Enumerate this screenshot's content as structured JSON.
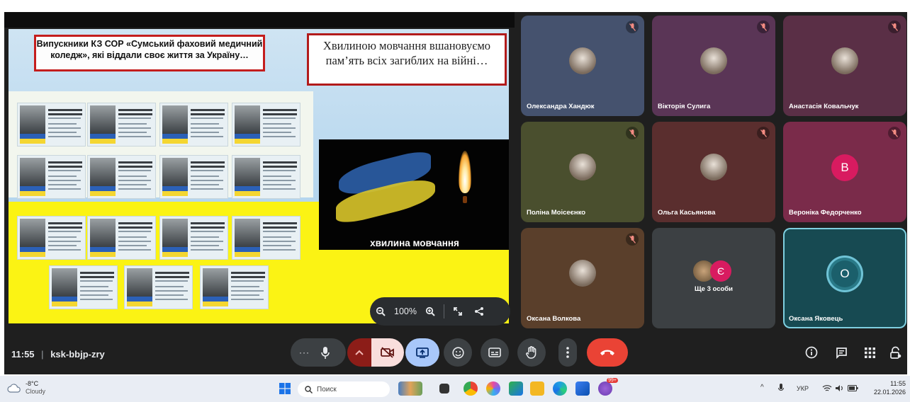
{
  "meeting": {
    "time": "11:55",
    "separator": "|",
    "code": "ksk-bbjp-zry"
  },
  "slide": {
    "title": "Випускники КЗ СОР «Сумський фаховий медичний коледж», які віддали своє життя за Україну…",
    "quote": "Хвилиною мовчання вшановуємо пам’ять всіх загиблих на війні…",
    "video_caption": "хвилина мовчання"
  },
  "zoom_bar": {
    "zoom_out_icon": "zoom-out-icon",
    "zoom_level": "100%",
    "zoom_in_icon": "zoom-in-icon"
  },
  "participants": [
    {
      "name": "Олександра Хандюк",
      "bg": "#45526e",
      "mic": "muted"
    },
    {
      "name": "Вікторія Сулига",
      "bg": "#5a3556",
      "mic": "muted"
    },
    {
      "name": "Анастасія Ковальчук",
      "bg": "#5a2f46",
      "mic": "muted"
    },
    {
      "name": "Поліна Моісеєнко",
      "bg": "#4a4f2e",
      "mic": "muted"
    },
    {
      "name": "Ольга Касьянова",
      "bg": "#5a2e2e",
      "mic": "muted"
    },
    {
      "name": "Вероніка Федорченко",
      "bg": "#7a2b4a",
      "mic": "muted",
      "initial": "В"
    },
    {
      "name": "Оксана Волкова",
      "bg": "#5a3f2b",
      "mic": "muted"
    },
    {
      "name": "Ще 3 особи",
      "bg": "#3c4043",
      "initial": "Є"
    },
    {
      "name": "Оксана Яковець",
      "bg": "#174a52",
      "initial": "О"
    }
  ],
  "controls": {
    "more_label": "···",
    "items": [
      "more-options",
      "microphone",
      "camera-options",
      "camera-off",
      "present-screen",
      "reactions",
      "captions",
      "raise-hand",
      "more-vert",
      "leave-call"
    ]
  },
  "right_icons": [
    "info-icon",
    "chat-icon",
    "activities-icon",
    "host-controls-icon"
  ],
  "taskbar": {
    "weather_temp": "-8°C",
    "weather_text": "Cloudy",
    "search_placeholder": "Поиск",
    "lang": "УКР",
    "time": "11:55",
    "date": "22.01.2026",
    "badge": "99+"
  },
  "colors": {
    "meet_bg": "#1f1f1f",
    "leave": "#ea4335",
    "present_active": "#a8c7fa",
    "cam_off": "#f9dedc"
  }
}
